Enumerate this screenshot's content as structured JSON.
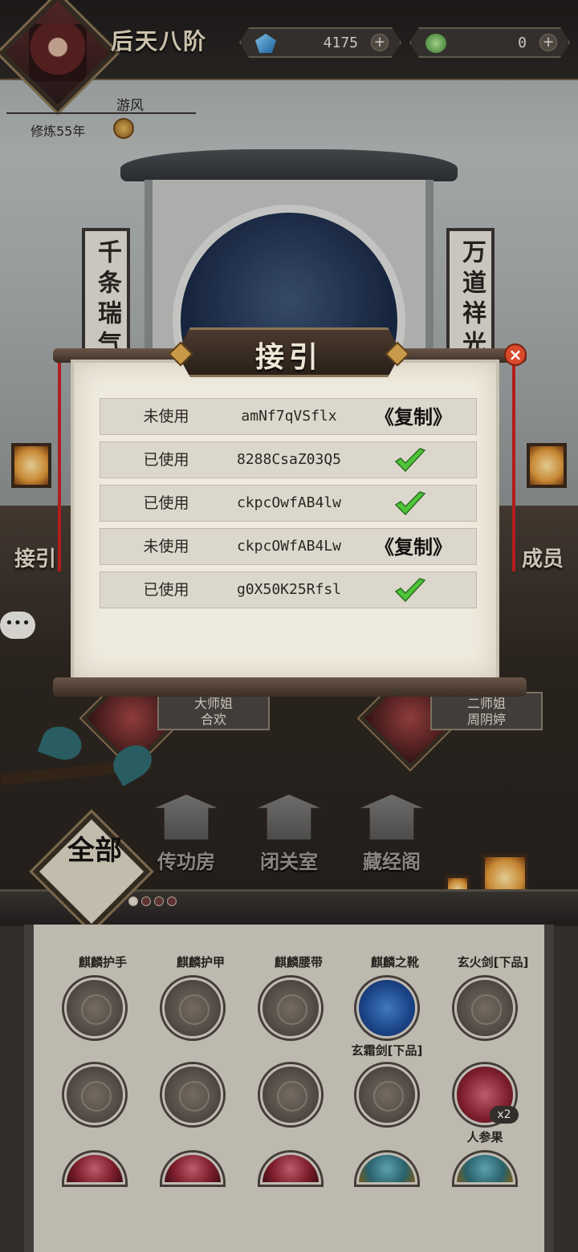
{
  "header": {
    "realm": "后天八阶",
    "resources": [
      {
        "icon": "blue-crystal-icon",
        "value": "4175"
      },
      {
        "icon": "jade-icon",
        "value": "0"
      }
    ],
    "player_name": "游风",
    "cultivation": "修炼55年"
  },
  "scene": {
    "couplet_left": "千条瑞气",
    "couplet_right": "万道祥光",
    "side_left_label": "接引",
    "side_right_label": "成员",
    "sisters": [
      {
        "line1": "大师姐",
        "line2": "合欢"
      },
      {
        "line1": "二师姐",
        "line2": "周阴婷"
      }
    ],
    "buildings": [
      "传功房",
      "闭关室",
      "藏经阁"
    ],
    "all_tab_label": "全部",
    "chat_label": "•••"
  },
  "inventory": {
    "top_labels": [
      "麒麟护手",
      "麒麟护甲",
      "麒麟腰带",
      "麒麟之靴",
      "玄火剑[下品]"
    ],
    "item_labels": {
      "xuanshuang": "玄霜剑[下品]",
      "renshen": "人参果"
    },
    "renshen_count": "x2"
  },
  "modal": {
    "title": "接引",
    "close_label": "×",
    "copy_label": "《复制》",
    "codes": [
      {
        "status": "未使用",
        "code": "amNf7qVSflx",
        "used": false
      },
      {
        "status": "已使用",
        "code": "8288CsaZ03Q5",
        "used": true
      },
      {
        "status": "已使用",
        "code": "ckpcOwfAB4lw",
        "used": true
      },
      {
        "status": "未使用",
        "code": "ckpcOWfAB4Lw",
        "used": false
      },
      {
        "status": "已使用",
        "code": "g0X50K25Rfsl",
        "used": true
      }
    ]
  },
  "colors": {
    "accent": "#8b7555",
    "check": "#4fc43a",
    "ribbon": "#b21d1d"
  }
}
